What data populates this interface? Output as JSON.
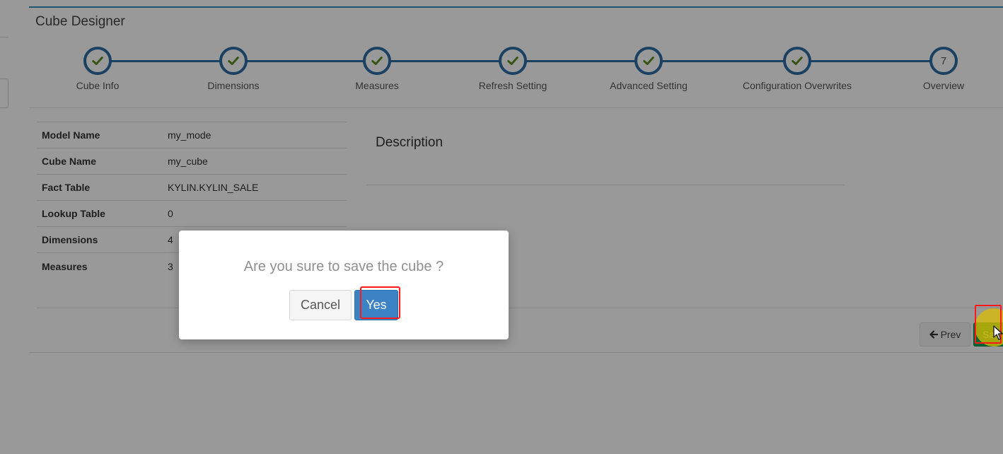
{
  "panel": {
    "title": "Cube Designer"
  },
  "wizard": {
    "steps": [
      {
        "label": "Cube Info",
        "status": "done",
        "icon": "check-icon"
      },
      {
        "label": "Dimensions",
        "status": "done",
        "icon": "check-icon"
      },
      {
        "label": "Measures",
        "status": "done",
        "icon": "check-icon"
      },
      {
        "label": "Refresh Setting",
        "status": "done",
        "icon": "check-icon"
      },
      {
        "label": "Advanced Setting",
        "status": "done",
        "icon": "check-icon"
      },
      {
        "label": "Configuration Overwrites",
        "status": "done",
        "icon": "check-icon"
      },
      {
        "label": "Overview",
        "status": "current",
        "number": "7"
      }
    ],
    "line_color": "#2e6da4",
    "check_color": "#5c8a1f"
  },
  "overview": {
    "rows": [
      {
        "key": "Model Name",
        "value": "my_mode"
      },
      {
        "key": "Cube Name",
        "value": "my_cube"
      },
      {
        "key": "Fact Table",
        "value": "KYLIN.KYLIN_SALE"
      },
      {
        "key": "Lookup Table",
        "value": "0"
      },
      {
        "key": "Dimensions",
        "value": "4"
      },
      {
        "key": "Measures",
        "value": "3"
      }
    ],
    "description_title": "Description"
  },
  "footer": {
    "prev_label": "Prev",
    "prev_icon": "arrow-left-icon",
    "save_label": "Sa"
  },
  "dialog": {
    "message": "Are you sure to save the cube ?",
    "cancel_label": "Cancel",
    "yes_label": "Yes"
  },
  "colors": {
    "overlay": "rgba(0,0,0,0.4)",
    "highlight": "#ff1a1a",
    "yes_button": "#3c83c5",
    "save_button": "#00a65a"
  }
}
